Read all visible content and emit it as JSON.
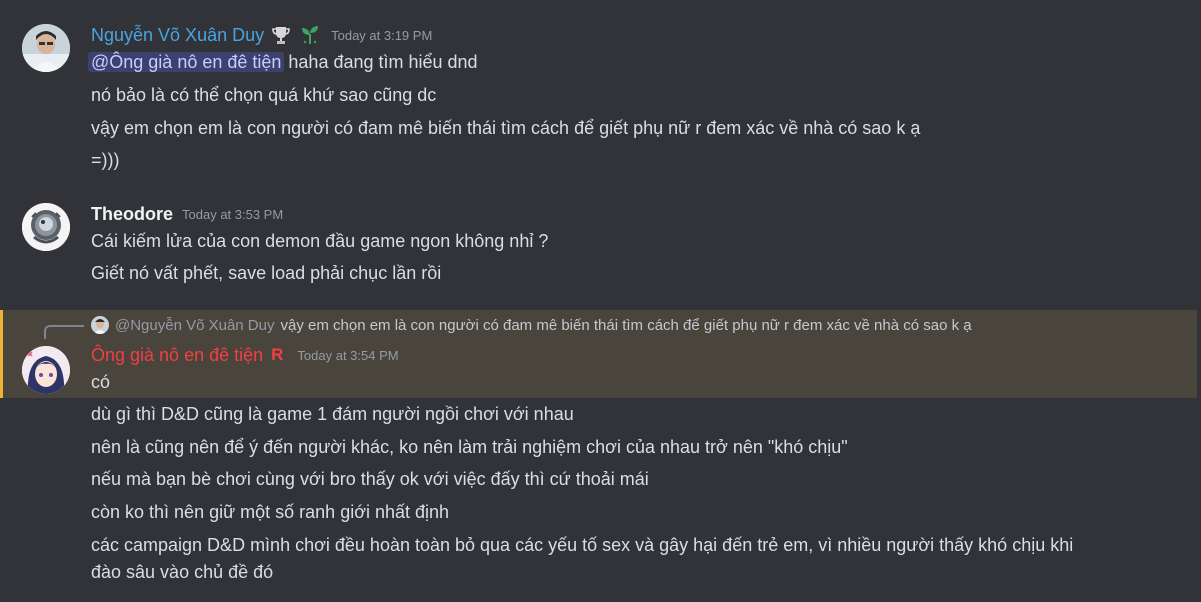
{
  "messages": [
    {
      "username": "Nguyễn Võ Xuân Duy",
      "username_color": "#4aa3df",
      "timestamp": "Today at 3:19 PM",
      "badges": [
        "trophy-icon",
        "sprout-icon"
      ],
      "mention": "@Ông già nô en đê tiện",
      "lines": [
        "haha đang tìm hiểu dnd",
        "nó bảo là có thể chọn quá khứ sao cũng dc",
        "vậy em chọn em là con người có đam mê biến thái tìm cách để giết phụ nữ r đem xác về nhà có sao k ạ",
        "=)))"
      ]
    },
    {
      "username": "Theodore",
      "username_color": "#f2f3f5",
      "timestamp": "Today at 3:53 PM",
      "lines": [
        "Cái kiếm lửa của con demon đầu game ngon không nhỉ ?",
        "Giết nó vất phết, save load phải chục lần rồi"
      ]
    },
    {
      "reply": {
        "username": "@Nguyễn Võ Xuân Duy",
        "text": "vậy em chọn em là con người có đam mê biến thái tìm cách để giết phụ nữ r đem xác về nhà có sao k ạ"
      },
      "username": "Ông già nô en đê tiện",
      "username_color": "#f23f42",
      "role_icon": "R",
      "timestamp": "Today at 3:54 PM",
      "lines": [
        "có",
        "dù gì thì D&D cũng là game 1 đám người ngồi chơi với nhau",
        "nên là cũng nên để ý đến người khác, ko nên làm trải nghiệm chơi của nhau trở nên \"khó chịu\"",
        "nếu mà bạn bè chơi cùng với bro thấy ok với việc đấy thì cứ thoải mái",
        "còn ko thì nên giữ một số ranh giới nhất định",
        "các campaign D&D mình chơi đều hoàn toàn bỏ qua các yếu tố sex và gây hại đến trẻ em, vì nhiều người thấy khó chịu khi",
        "đào sâu vào chủ đề đó"
      ]
    }
  ],
  "colors": {
    "background": "#313338",
    "highlight": "#49443c",
    "highlight_bar": "#f0b232",
    "mention_bg": "#3c4270"
  }
}
